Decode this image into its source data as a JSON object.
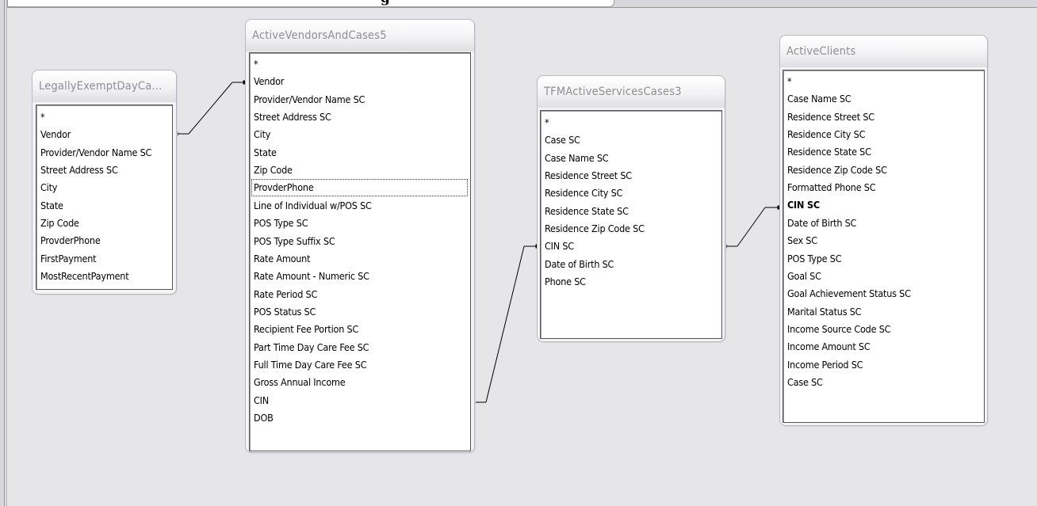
{
  "window": {
    "title_fragment": "g"
  },
  "tables": [
    {
      "id": "legally-exempt",
      "title": "LegallyExemptDayCa...",
      "fields": [
        "*",
        "Vendor",
        "Provider/Vendor Name SC",
        "Street Address SC",
        "City",
        "State",
        "Zip Code",
        "ProvderPhone",
        "FirstPayment",
        "MostRecentPayment"
      ]
    },
    {
      "id": "active-vendors",
      "title": "ActiveVendorsAndCases5",
      "fields": [
        "*",
        "Vendor",
        "Provider/Vendor Name SC",
        "Street Address SC",
        "City",
        "State",
        "Zip Code",
        "ProvderPhone",
        "Line  of Individual w/POS SC",
        "POS Type SC",
        "POS Type Suffix SC",
        "Rate Amount",
        "Rate Amount - Numeric SC",
        "Rate Period SC",
        "POS Status SC",
        "Recipient Fee Portion SC",
        "Part Time Day Care Fee SC",
        "Full Time Day Care Fee SC",
        "Gross Annual Income",
        "CIN",
        "DOB"
      ],
      "focused_field": "ProvderPhone"
    },
    {
      "id": "tfm-active",
      "title": "TFMActiveServicesCases3",
      "fields": [
        "*",
        "Case  SC",
        "Case Name SC",
        "Residence Street SC",
        "Residence City SC",
        "Residence State SC",
        "Residence Zip Code SC",
        "CIN SC",
        "Date of Birth SC",
        "Phone SC"
      ]
    },
    {
      "id": "active-clients",
      "title": "ActiveClients",
      "fields": [
        "*",
        "Case Name SC",
        "Residence Street SC",
        "Residence City SC",
        "Residence State SC",
        "Residence Zip Code SC",
        "Formatted Phone SC",
        "CIN SC",
        "Date of Birth SC",
        "Sex SC",
        "POS Type SC",
        "Goal SC",
        "Goal Achievement Status SC",
        "Marital Status SC",
        "Income Source Code SC",
        "Income Amount SC",
        "Income Period SC",
        "Case  SC"
      ],
      "bold_field": "CIN SC"
    }
  ],
  "relationships": [
    {
      "from": "LegallyExemptDayCa....Vendor",
      "to": "ActiveVendorsAndCases5.Vendor"
    },
    {
      "from": "ActiveVendorsAndCases5.CIN",
      "to": "TFMActiveServicesCases3.CIN SC"
    },
    {
      "from": "TFMActiveServicesCases3.CIN SC",
      "to": "ActiveClients.CIN SC"
    }
  ]
}
